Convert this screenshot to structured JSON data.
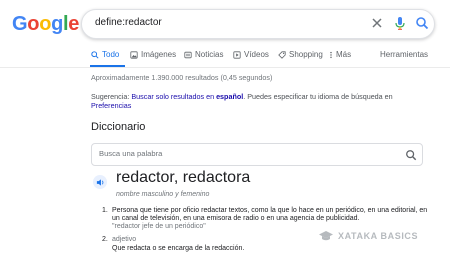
{
  "logo": {
    "text": "Google",
    "letters": [
      "G",
      "o",
      "o",
      "g",
      "l",
      "e"
    ],
    "colors": [
      "#4285f4",
      "#ea4335",
      "#fbbc05",
      "#4285f4",
      "#34a853",
      "#ea4335"
    ]
  },
  "search": {
    "query": "define:redactor"
  },
  "tabs": [
    {
      "label": "Todo",
      "icon": "search-icon",
      "active": true
    },
    {
      "label": "Imágenes",
      "icon": "image-icon",
      "active": false
    },
    {
      "label": "Noticias",
      "icon": "news-icon",
      "active": false
    },
    {
      "label": "Vídeos",
      "icon": "video-icon",
      "active": false
    },
    {
      "label": "Shopping",
      "icon": "tag-icon",
      "active": false
    },
    {
      "label": "Más",
      "icon": "more-icon",
      "active": false
    }
  ],
  "tools_label": "Herramientas",
  "results_stats": "Aproximadamente 1.390.000 resultados (0,45 segundos)",
  "suggestion": {
    "prefix": "Sugerencia: ",
    "link_text": "Buscar solo resultados en ",
    "link_bold": "español",
    "middle": ". Puedes especificar tu idioma de búsqueda en ",
    "settings_link": "Preferencias"
  },
  "dictionary": {
    "title": "Diccionario",
    "search_placeholder": "Busca una palabra",
    "headword": "redactor, redactora",
    "gender_note": "nombre masculino y femenino",
    "definitions": [
      {
        "number": "1.",
        "text": "Persona que tiene por oficio redactar textos, como la que lo hace en un periódico, en una editorial, en un canal de televisión, en una emisora de radio o en una agencia de publicidad.",
        "example": "\"redactor jefe de un periódico\""
      },
      {
        "number": "2.",
        "part_of_speech": "adjetivo",
        "text": "Que redacta o se encarga de la redacción."
      }
    ]
  },
  "watermark": {
    "text": "XATAKA BASICS",
    "icon": "graduation-cap-icon"
  },
  "colors": {
    "accent": "#1a73e8",
    "link": "#1a0dab",
    "muted": "#70757a"
  }
}
